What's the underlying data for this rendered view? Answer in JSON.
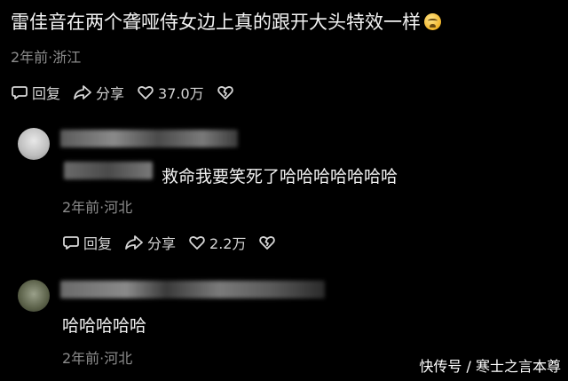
{
  "post": {
    "text": "雷佳音在两个聋哑侍女边上真的跟开大头特效一样",
    "emoji": "anxious-sweat-emoji",
    "meta": "2年前·浙江",
    "actions": {
      "reply": "回复",
      "share": "分享",
      "likes": "37.0万"
    }
  },
  "comments": [
    {
      "username": "",
      "text": "救命我要笑死了哈哈哈哈哈哈哈",
      "meta": "2年前·河北",
      "actions": {
        "reply": "回复",
        "share": "分享",
        "likes": "2.2万"
      }
    },
    {
      "username": "",
      "text": "哈哈哈哈哈",
      "meta": "2年前·河北"
    }
  ],
  "watermark": "快传号 / 寒士之言本尊"
}
